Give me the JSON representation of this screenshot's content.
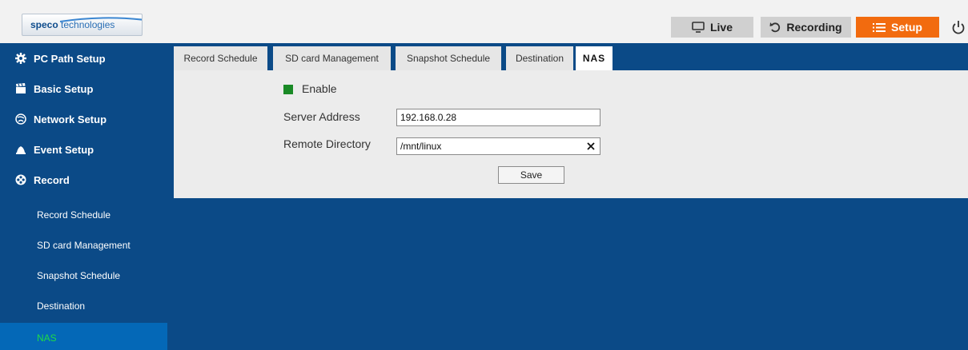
{
  "header": {
    "logo_brand": "speco",
    "logo_suffix": " technologies",
    "nav": {
      "live": "Live",
      "recording": "Recording",
      "setup": "Setup"
    }
  },
  "sidebar": {
    "main": [
      {
        "label": "PC Path Setup",
        "icon": "gear-icon"
      },
      {
        "label": "Basic Setup",
        "icon": "clapperboard-icon"
      },
      {
        "label": "Network Setup",
        "icon": "network-icon"
      },
      {
        "label": "Event Setup",
        "icon": "bell-icon"
      },
      {
        "label": "Record",
        "icon": "reel-icon"
      }
    ],
    "sub": [
      {
        "label": "Record Schedule"
      },
      {
        "label": "SD card Management"
      },
      {
        "label": "Snapshot Schedule"
      },
      {
        "label": "Destination"
      },
      {
        "label": "NAS",
        "active": true
      }
    ]
  },
  "tabs": [
    {
      "label": "Record Schedule"
    },
    {
      "label": "SD card Management"
    },
    {
      "label": "Snapshot Schedule"
    },
    {
      "label": "Destination"
    },
    {
      "label": "NAS",
      "active": true
    }
  ],
  "form": {
    "enable_label": "Enable",
    "enable_checked": true,
    "server_address_label": "Server Address",
    "server_address_value": "192.168.0.28",
    "remote_directory_label": "Remote Directory",
    "remote_directory_value": "/mnt/linux",
    "save_label": "Save"
  },
  "colors": {
    "sidebar_bg": "#0b4a87",
    "active_item_bg": "#0468b7",
    "active_item_text": "#1edc46",
    "setup_button": "#f26b0f",
    "enable_checkbox": "#1a8a26"
  }
}
